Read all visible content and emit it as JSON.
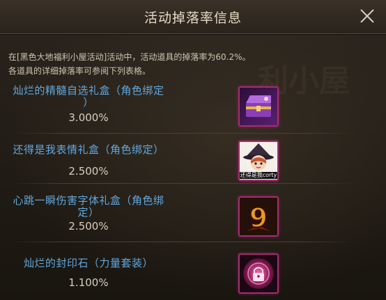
{
  "dialog": {
    "title": "活动掉落率信息",
    "close_icon": "close-icon"
  },
  "notice": {
    "line1": "在[黑色大地福利小屋活动]活动中，活动道具的掉落率为60.2%。",
    "line2": "各道具的详细掉落率可参阅下列表格。"
  },
  "items": [
    {
      "name_line1": "灿烂的精髓自选礼盒（角色绑定",
      "name_line2": "）",
      "rate": "3.000%",
      "icon": "purple-treasure-chest-icon"
    },
    {
      "name_line1": "还得是我表情礼盒（角色绑定）",
      "rate": "2.500%",
      "icon": "witch-emoticon-icon",
      "icon_caption": "还得是我corty"
    },
    {
      "name_line1": "心跳一瞬伤害字体礼盒（角色绑",
      "name_line2": "定）",
      "rate": "2.500%",
      "icon": "damage-font-number-9-icon"
    },
    {
      "name_line1": "灿烂的封印石（力量套装）",
      "rate": "1.100%",
      "icon": "pink-lock-seal-stone-icon"
    }
  ],
  "colors": {
    "item_name": "#62a8de",
    "rate_text": "#d9cfbf",
    "icon_border": "#a82a73",
    "title_text": "#e8dcc6"
  }
}
